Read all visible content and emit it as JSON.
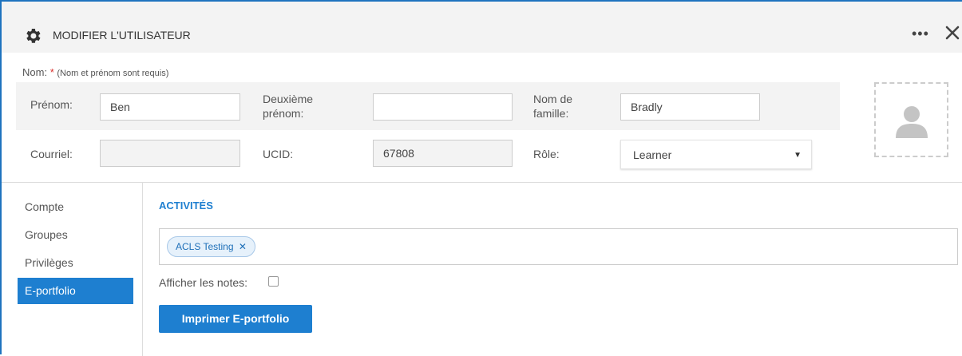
{
  "header": {
    "title": "MODIFIER L'UTILISATEUR",
    "gear_icon": "gear-icon",
    "more_icon": "more-horizontal-icon",
    "more_glyph": "•••",
    "close_icon": "close-icon"
  },
  "name_section": {
    "label": "Nom:",
    "required_mark": "*",
    "hint": "(Nom et prénom sont requis)"
  },
  "fields": {
    "first_name": {
      "label": "Prénom:",
      "value": "Ben"
    },
    "middle_name": {
      "label_line1": "Deuxième",
      "label_line2": "prénom:",
      "value": ""
    },
    "last_name": {
      "label_line1": "Nom de",
      "label_line2": "famille:",
      "value": "Bradly"
    },
    "email": {
      "label": "Courriel:",
      "value": ""
    },
    "ucid": {
      "label": "UCID:",
      "value": "67808"
    },
    "role": {
      "label": "Rôle:",
      "value": "Learner",
      "caret": "▼"
    }
  },
  "avatar": {
    "icon": "user-placeholder-icon"
  },
  "sidebar": {
    "items": [
      {
        "label": "Compte",
        "active": false
      },
      {
        "label": "Groupes",
        "active": false
      },
      {
        "label": "Privilèges",
        "active": false
      },
      {
        "label": "E-portfolio",
        "active": true
      }
    ]
  },
  "main": {
    "section_title": "ACTIVITÉS",
    "tags": [
      {
        "label": "ACLS Testing",
        "remove": "✕"
      }
    ],
    "show_notes_label": "Afficher les notes:",
    "show_notes_checked": false,
    "print_button": "Imprimer E-portfolio"
  },
  "colors": {
    "accent": "#1e7fd0",
    "frame_border": "#1e73be",
    "required": "#d9302c",
    "header_bg": "#f3f3f3"
  }
}
